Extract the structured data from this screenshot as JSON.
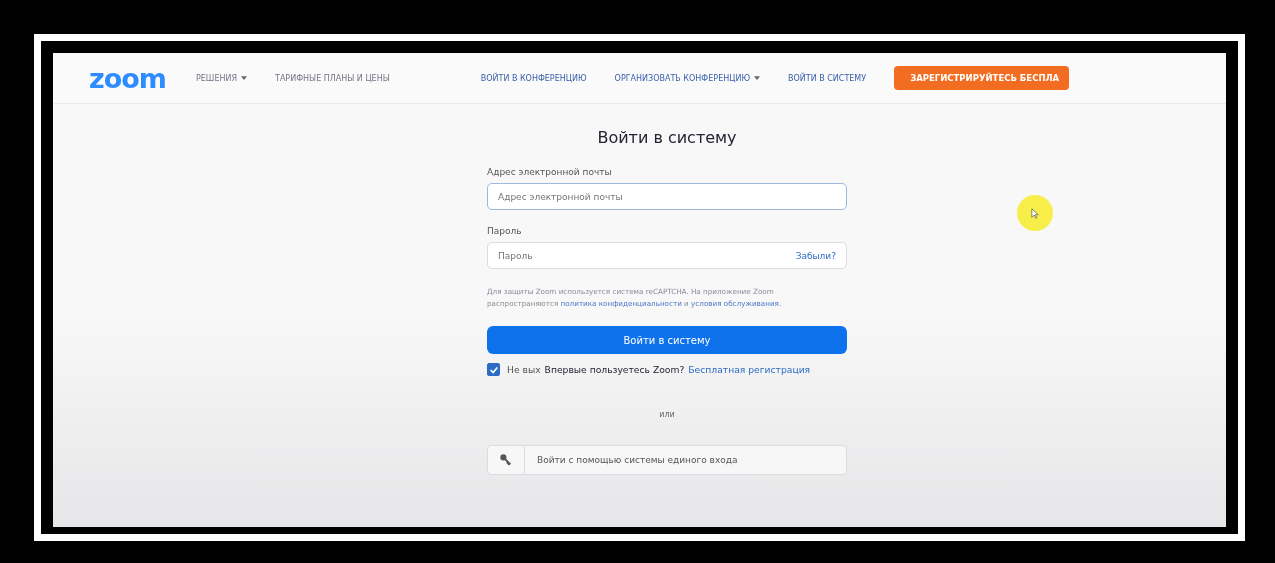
{
  "nav": {
    "logo": "zoom",
    "left_links": [
      {
        "label": "РЕШЕНИЯ",
        "dropdown": true
      },
      {
        "label": "ТАРИФНЫЕ ПЛАНЫ И ЦЕНЫ",
        "dropdown": false
      }
    ],
    "right_links": [
      {
        "label": "ВОЙТИ В КОНФЕРЕНЦИЮ",
        "dropdown": false
      },
      {
        "label": "ОРГАНИЗОВАТЬ КОНФЕРЕНЦИЮ",
        "dropdown": true
      },
      {
        "label": "ВОЙТИ В СИСТЕМУ",
        "dropdown": false
      }
    ],
    "signup_button": "ЗАРЕГИСТРИРУЙТЕСЬ БЕСПЛА"
  },
  "form": {
    "title": "Войти в систему",
    "email": {
      "label": "Адрес электронной почты",
      "placeholder": "Адрес электронной почты"
    },
    "password": {
      "label": "Пароль",
      "placeholder": "Пароль",
      "forgot_link": "Забыли?"
    },
    "notice": {
      "text_before": "Для защиты Zoom используется система reCAPTCHA. На приложение Zoom распространяются",
      "privacy_link": "политика конфиденциальности",
      "joiner": "и",
      "terms_link": "условия обслуживания",
      "text_after": "."
    },
    "submit_button": "Войти в систему",
    "stay_signed_in": {
      "label": "Не вых",
      "checked": true
    },
    "new_user_text": "Впервые пользуетесь Zoom?",
    "register_link": "Бесплатная регистрация",
    "divider_text": "или",
    "sso_button": "Войти с помощью системы единого входа"
  }
}
